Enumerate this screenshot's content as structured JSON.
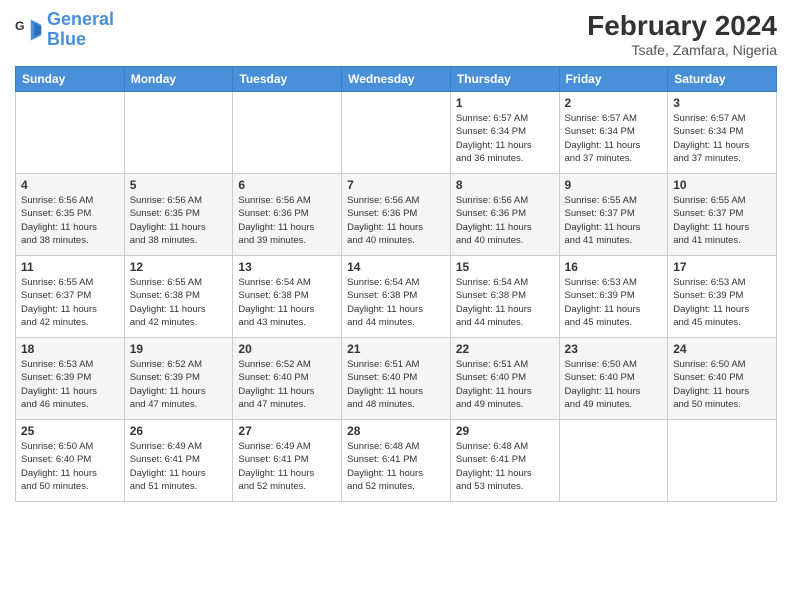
{
  "header": {
    "logo": {
      "line1": "General",
      "line2": "Blue"
    },
    "title": "February 2024",
    "location": "Tsafe, Zamfara, Nigeria"
  },
  "weekdays": [
    "Sunday",
    "Monday",
    "Tuesday",
    "Wednesday",
    "Thursday",
    "Friday",
    "Saturday"
  ],
  "weeks": [
    [
      {
        "day": "",
        "info": ""
      },
      {
        "day": "",
        "info": ""
      },
      {
        "day": "",
        "info": ""
      },
      {
        "day": "",
        "info": ""
      },
      {
        "day": "1",
        "info": "Sunrise: 6:57 AM\nSunset: 6:34 PM\nDaylight: 11 hours\nand 36 minutes."
      },
      {
        "day": "2",
        "info": "Sunrise: 6:57 AM\nSunset: 6:34 PM\nDaylight: 11 hours\nand 37 minutes."
      },
      {
        "day": "3",
        "info": "Sunrise: 6:57 AM\nSunset: 6:34 PM\nDaylight: 11 hours\nand 37 minutes."
      }
    ],
    [
      {
        "day": "4",
        "info": "Sunrise: 6:56 AM\nSunset: 6:35 PM\nDaylight: 11 hours\nand 38 minutes."
      },
      {
        "day": "5",
        "info": "Sunrise: 6:56 AM\nSunset: 6:35 PM\nDaylight: 11 hours\nand 38 minutes."
      },
      {
        "day": "6",
        "info": "Sunrise: 6:56 AM\nSunset: 6:36 PM\nDaylight: 11 hours\nand 39 minutes."
      },
      {
        "day": "7",
        "info": "Sunrise: 6:56 AM\nSunset: 6:36 PM\nDaylight: 11 hours\nand 40 minutes."
      },
      {
        "day": "8",
        "info": "Sunrise: 6:56 AM\nSunset: 6:36 PM\nDaylight: 11 hours\nand 40 minutes."
      },
      {
        "day": "9",
        "info": "Sunrise: 6:55 AM\nSunset: 6:37 PM\nDaylight: 11 hours\nand 41 minutes."
      },
      {
        "day": "10",
        "info": "Sunrise: 6:55 AM\nSunset: 6:37 PM\nDaylight: 11 hours\nand 41 minutes."
      }
    ],
    [
      {
        "day": "11",
        "info": "Sunrise: 6:55 AM\nSunset: 6:37 PM\nDaylight: 11 hours\nand 42 minutes."
      },
      {
        "day": "12",
        "info": "Sunrise: 6:55 AM\nSunset: 6:38 PM\nDaylight: 11 hours\nand 42 minutes."
      },
      {
        "day": "13",
        "info": "Sunrise: 6:54 AM\nSunset: 6:38 PM\nDaylight: 11 hours\nand 43 minutes."
      },
      {
        "day": "14",
        "info": "Sunrise: 6:54 AM\nSunset: 6:38 PM\nDaylight: 11 hours\nand 44 minutes."
      },
      {
        "day": "15",
        "info": "Sunrise: 6:54 AM\nSunset: 6:38 PM\nDaylight: 11 hours\nand 44 minutes."
      },
      {
        "day": "16",
        "info": "Sunrise: 6:53 AM\nSunset: 6:39 PM\nDaylight: 11 hours\nand 45 minutes."
      },
      {
        "day": "17",
        "info": "Sunrise: 6:53 AM\nSunset: 6:39 PM\nDaylight: 11 hours\nand 45 minutes."
      }
    ],
    [
      {
        "day": "18",
        "info": "Sunrise: 6:53 AM\nSunset: 6:39 PM\nDaylight: 11 hours\nand 46 minutes."
      },
      {
        "day": "19",
        "info": "Sunrise: 6:52 AM\nSunset: 6:39 PM\nDaylight: 11 hours\nand 47 minutes."
      },
      {
        "day": "20",
        "info": "Sunrise: 6:52 AM\nSunset: 6:40 PM\nDaylight: 11 hours\nand 47 minutes."
      },
      {
        "day": "21",
        "info": "Sunrise: 6:51 AM\nSunset: 6:40 PM\nDaylight: 11 hours\nand 48 minutes."
      },
      {
        "day": "22",
        "info": "Sunrise: 6:51 AM\nSunset: 6:40 PM\nDaylight: 11 hours\nand 49 minutes."
      },
      {
        "day": "23",
        "info": "Sunrise: 6:50 AM\nSunset: 6:40 PM\nDaylight: 11 hours\nand 49 minutes."
      },
      {
        "day": "24",
        "info": "Sunrise: 6:50 AM\nSunset: 6:40 PM\nDaylight: 11 hours\nand 50 minutes."
      }
    ],
    [
      {
        "day": "25",
        "info": "Sunrise: 6:50 AM\nSunset: 6:40 PM\nDaylight: 11 hours\nand 50 minutes."
      },
      {
        "day": "26",
        "info": "Sunrise: 6:49 AM\nSunset: 6:41 PM\nDaylight: 11 hours\nand 51 minutes."
      },
      {
        "day": "27",
        "info": "Sunrise: 6:49 AM\nSunset: 6:41 PM\nDaylight: 11 hours\nand 52 minutes."
      },
      {
        "day": "28",
        "info": "Sunrise: 6:48 AM\nSunset: 6:41 PM\nDaylight: 11 hours\nand 52 minutes."
      },
      {
        "day": "29",
        "info": "Sunrise: 6:48 AM\nSunset: 6:41 PM\nDaylight: 11 hours\nand 53 minutes."
      },
      {
        "day": "",
        "info": ""
      },
      {
        "day": "",
        "info": ""
      }
    ]
  ]
}
